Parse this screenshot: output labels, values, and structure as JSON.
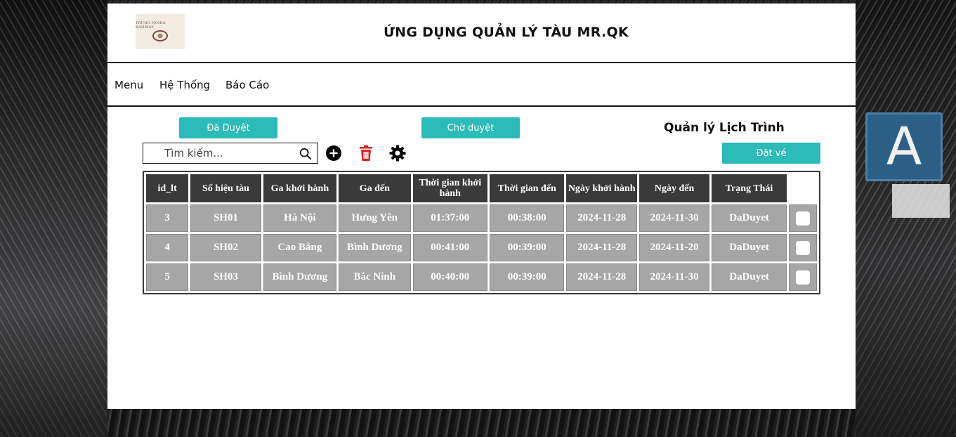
{
  "app": {
    "logo_text": "TRUNG NGHIA RAILWAY",
    "title": "ỨNG DỤNG QUẢN LÝ TÀU MR.QK"
  },
  "nav": {
    "menu": "Menu",
    "system": "Hệ Thống",
    "report": "Báo Cáo"
  },
  "filters": {
    "approved_label": "Đã Duyệt",
    "pending_label": "Chờ duyệt"
  },
  "section_title": "Quản lý Lịch Trình",
  "search": {
    "placeholder": "Tìm kiếm..."
  },
  "toolbar": {
    "add_icon": "plus-circle-icon",
    "delete_icon": "trash-icon",
    "settings_icon": "gear-icon",
    "book_label": "Đặt vé"
  },
  "colors": {
    "accent": "#2bbbb9",
    "delete": "#e02020",
    "header_cell": "#3a3a3a",
    "body_cell": "#a6a6a6"
  },
  "table": {
    "columns": [
      "id_lt",
      "Số hiệu tàu",
      "Ga khởi hành",
      "Ga đến",
      "Thời gian khởi hành",
      "Thời gian đến",
      "Ngày khởi hành",
      "Ngày đến",
      "Trạng Thái"
    ],
    "rows": [
      [
        "3",
        "SH01",
        "Hà Nội",
        "Hưng Yên",
        "01:37:00",
        "00:38:00",
        "2024-11-28",
        "2024-11-30",
        "DaDuyet"
      ],
      [
        "4",
        "SH02",
        "Cao Bằng",
        "Bình Dương",
        "00:41:00",
        "00:39:00",
        "2024-11-28",
        "2024-11-20",
        "DaDuyet"
      ],
      [
        "5",
        "SH03",
        "Bình Dương",
        "Bắc Ninh",
        "00:40:00",
        "00:39:00",
        "2024-11-28",
        "2024-11-30",
        "DaDuyet"
      ]
    ]
  },
  "background": {
    "sign_letter": "A"
  }
}
